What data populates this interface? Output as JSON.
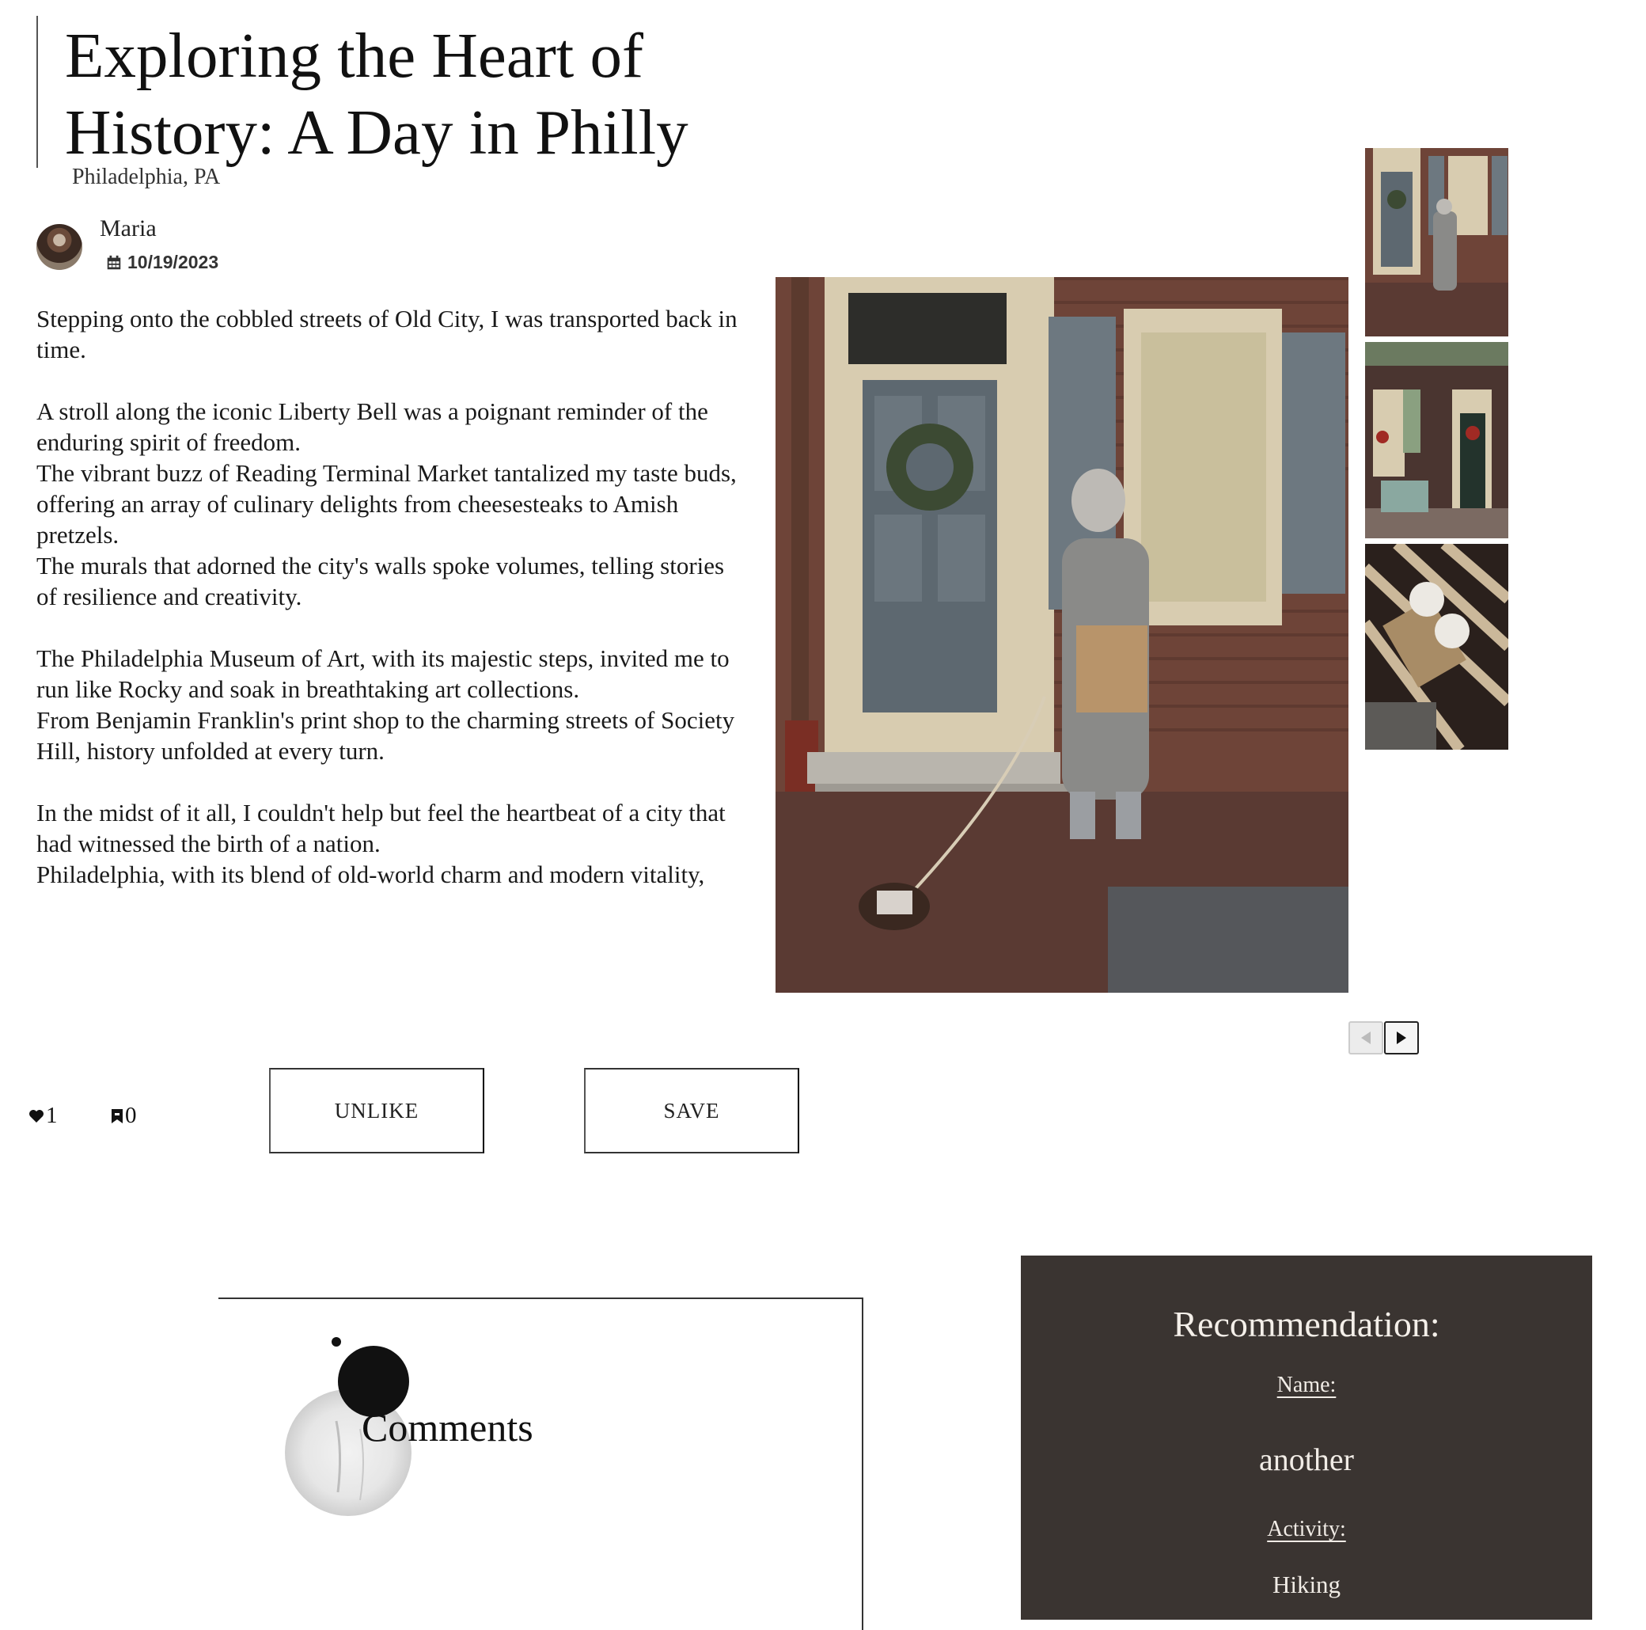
{
  "post": {
    "title": "Exploring the Heart of History: A Day in Philly",
    "location": "Philadelphia, PA",
    "author": "Maria",
    "date": "10/19/2023",
    "paragraphs": [
      [
        "Stepping onto the cobbled streets of Old City, I was transported back in time."
      ],
      [
        "A stroll along the iconic Liberty Bell was a poignant reminder of the enduring spirit of freedom.",
        "The vibrant buzz of Reading Terminal Market tantalized my taste buds,",
        "offering an array of culinary delights from cheesesteaks to Amish pretzels.",
        "The murals that adorned the city's walls spoke volumes, telling stories of resilience and creativity."
      ],
      [
        "The Philadelphia Museum of Art, with its majestic steps, invited me to run like Rocky and soak in breathtaking art collections.",
        "From Benjamin Franklin's print shop to the charming streets of Society Hill, history unfolded at every turn."
      ],
      [
        "In the midst of it all, I couldn't help but feel the heartbeat of a city that had witnessed the birth of a nation.",
        "Philadelphia, with its blend of old-world charm and modern vitality,"
      ]
    ]
  },
  "stats": {
    "likes": "1",
    "saves": "0"
  },
  "actions": {
    "unlike_label": "UNLIKE",
    "save_label": "SAVE"
  },
  "comments": {
    "title": "Comments"
  },
  "recommendation": {
    "heading": "Recommendation:",
    "name_label": "Name:",
    "name_value": "another",
    "activity_label": "Activity:",
    "activity_value": "Hiking"
  },
  "colors": {
    "panel_bg": "#3a3431",
    "panel_text": "#f1ece6",
    "text": "#1a1a1a"
  }
}
